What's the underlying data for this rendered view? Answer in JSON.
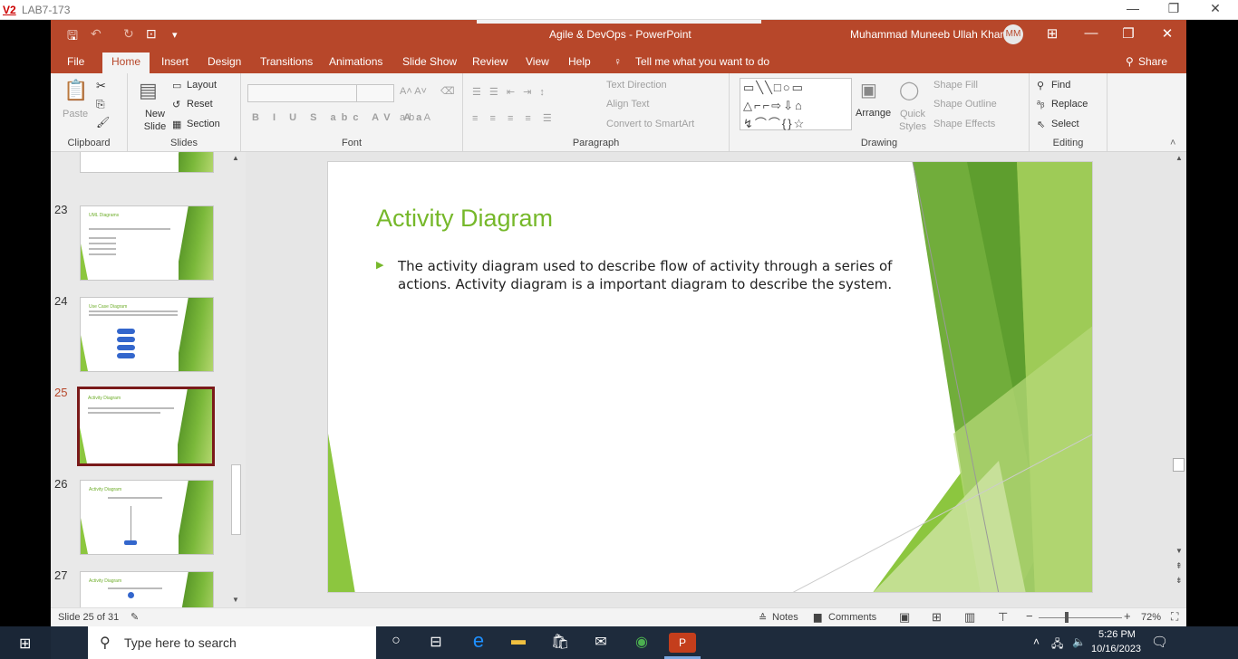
{
  "outer_window": {
    "logo": "V2",
    "title": "LAB7-173",
    "controls": [
      "—",
      "❐",
      "✕"
    ]
  },
  "titlebar": {
    "document": "Agile & DevOps  -  PowerPoint",
    "user": "Muhammad Muneeb Ullah Khan",
    "avatar": "MM"
  },
  "tabs": [
    "File",
    "Home",
    "Insert",
    "Design",
    "Transitions",
    "Animations",
    "Slide Show",
    "Review",
    "View",
    "Help"
  ],
  "tell_me": "Tell me what you want to do",
  "share": "Share",
  "ribbon": {
    "clipboard": {
      "paste": "Paste",
      "label": "Clipboard"
    },
    "slides": {
      "new_slide": "New Slide",
      "layout": "Layout",
      "reset": "Reset",
      "section": "Section",
      "label": "Slides"
    },
    "font": {
      "label": "Font"
    },
    "paragraph": {
      "text_direction": "Text Direction",
      "align_text": "Align Text",
      "convert_smartart": "Convert to SmartArt",
      "label": "Paragraph"
    },
    "drawing": {
      "arrange": "Arrange",
      "quick_styles": "Quick Styles",
      "shape_fill": "Shape Fill",
      "shape_outline": "Shape Outline",
      "shape_effects": "Shape Effects",
      "label": "Drawing"
    },
    "editing": {
      "find": "Find",
      "replace": "Replace",
      "select": "Select",
      "label": "Editing"
    }
  },
  "thumbnails": [
    {
      "num": "23",
      "title": "UML Diagrams"
    },
    {
      "num": "24",
      "title": "Use Case Diagram"
    },
    {
      "num": "25",
      "title": "Activity Diagram"
    },
    {
      "num": "26",
      "title": "Activity Diagram"
    },
    {
      "num": "27",
      "title": "Activity Diagram"
    }
  ],
  "slide": {
    "title": "Activity Diagram",
    "body": "The activity diagram used to describe flow of activity through a series of actions. Activity diagram is a important diagram to describe the system."
  },
  "status": {
    "slide_info": "Slide 25 of 31",
    "notes": "Notes",
    "comments": "Comments",
    "zoom": "72%"
  },
  "taskbar": {
    "search_placeholder": "Type here to search",
    "time": "5:26 PM",
    "date": "10/16/2023"
  }
}
